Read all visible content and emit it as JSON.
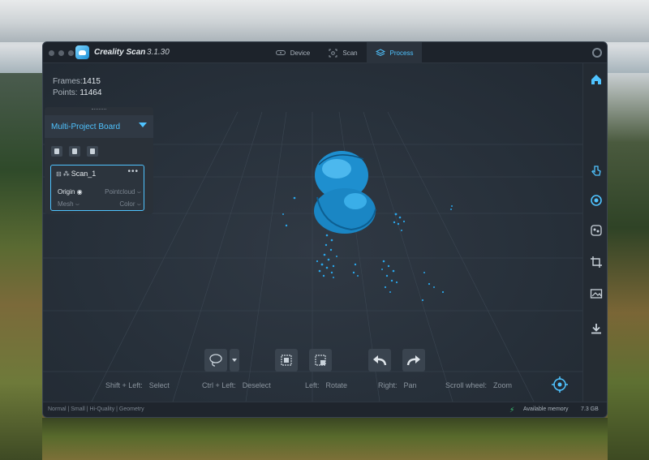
{
  "app": {
    "name": "Creality Scan",
    "version": "3.1.30"
  },
  "nav": {
    "tabs": [
      {
        "label": "Device",
        "icon": "device-icon",
        "active": false
      },
      {
        "label": "Scan",
        "icon": "scan-icon",
        "active": false
      },
      {
        "label": "Process",
        "icon": "layers-icon",
        "active": true
      }
    ]
  },
  "stats": {
    "frames_label": "Frames:",
    "frames_value": "1415",
    "points_label": "Points:",
    "points_value": "11464"
  },
  "board": {
    "title": "Multi-Project Board",
    "scan_item": {
      "name": "Scan_1",
      "origin": "Origin",
      "pointcloud": "Pointcloud",
      "mesh": "Mesh",
      "color": "Color"
    }
  },
  "hints": [
    {
      "key": "Shift + Left:",
      "action": "Select"
    },
    {
      "key": "Ctrl + Left:",
      "action": "Deselect"
    },
    {
      "key": "Left:",
      "action": "Rotate"
    },
    {
      "key": "Right:",
      "action": "Pan"
    },
    {
      "key": "Scroll wheel:",
      "action": "Zoom"
    }
  ],
  "status": {
    "mode": "Normal | Small | Hi-Quality | Geometry",
    "memory_label": "Available memory",
    "memory_value": "7.3 GB"
  },
  "colors": {
    "accent": "#4fc3ff",
    "pointcloud": "#1ea0e6"
  }
}
